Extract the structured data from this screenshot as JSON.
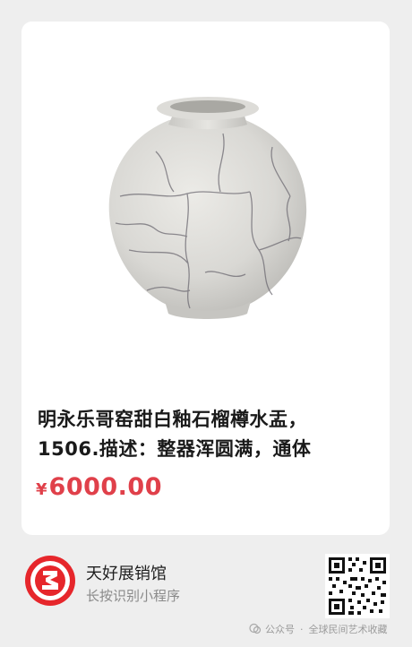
{
  "product": {
    "image_alt": "ge-kiln crackle-glaze pomegranate water pot",
    "title_line1": "明永乐哥窑甜白釉石榴樽水盂，",
    "title_line2": "1506.描述：整器浑圆满，通体",
    "currency_symbol": "¥",
    "price": "6000.00"
  },
  "mini_program": {
    "name": "天好展销馆",
    "subtitle": "长按识别小程序",
    "logo_icon": "red-circle-3-logo-icon",
    "qr_icon": "qr-code-icon"
  },
  "watermark": {
    "icon": "wechat-official-account-icon",
    "label": "公众号",
    "separator": "·",
    "account": "全球民间艺术收藏"
  },
  "colors": {
    "background": "#eeeeee",
    "card": "#ffffff",
    "price": "#e0404a",
    "logo_red": "#e6262b"
  }
}
